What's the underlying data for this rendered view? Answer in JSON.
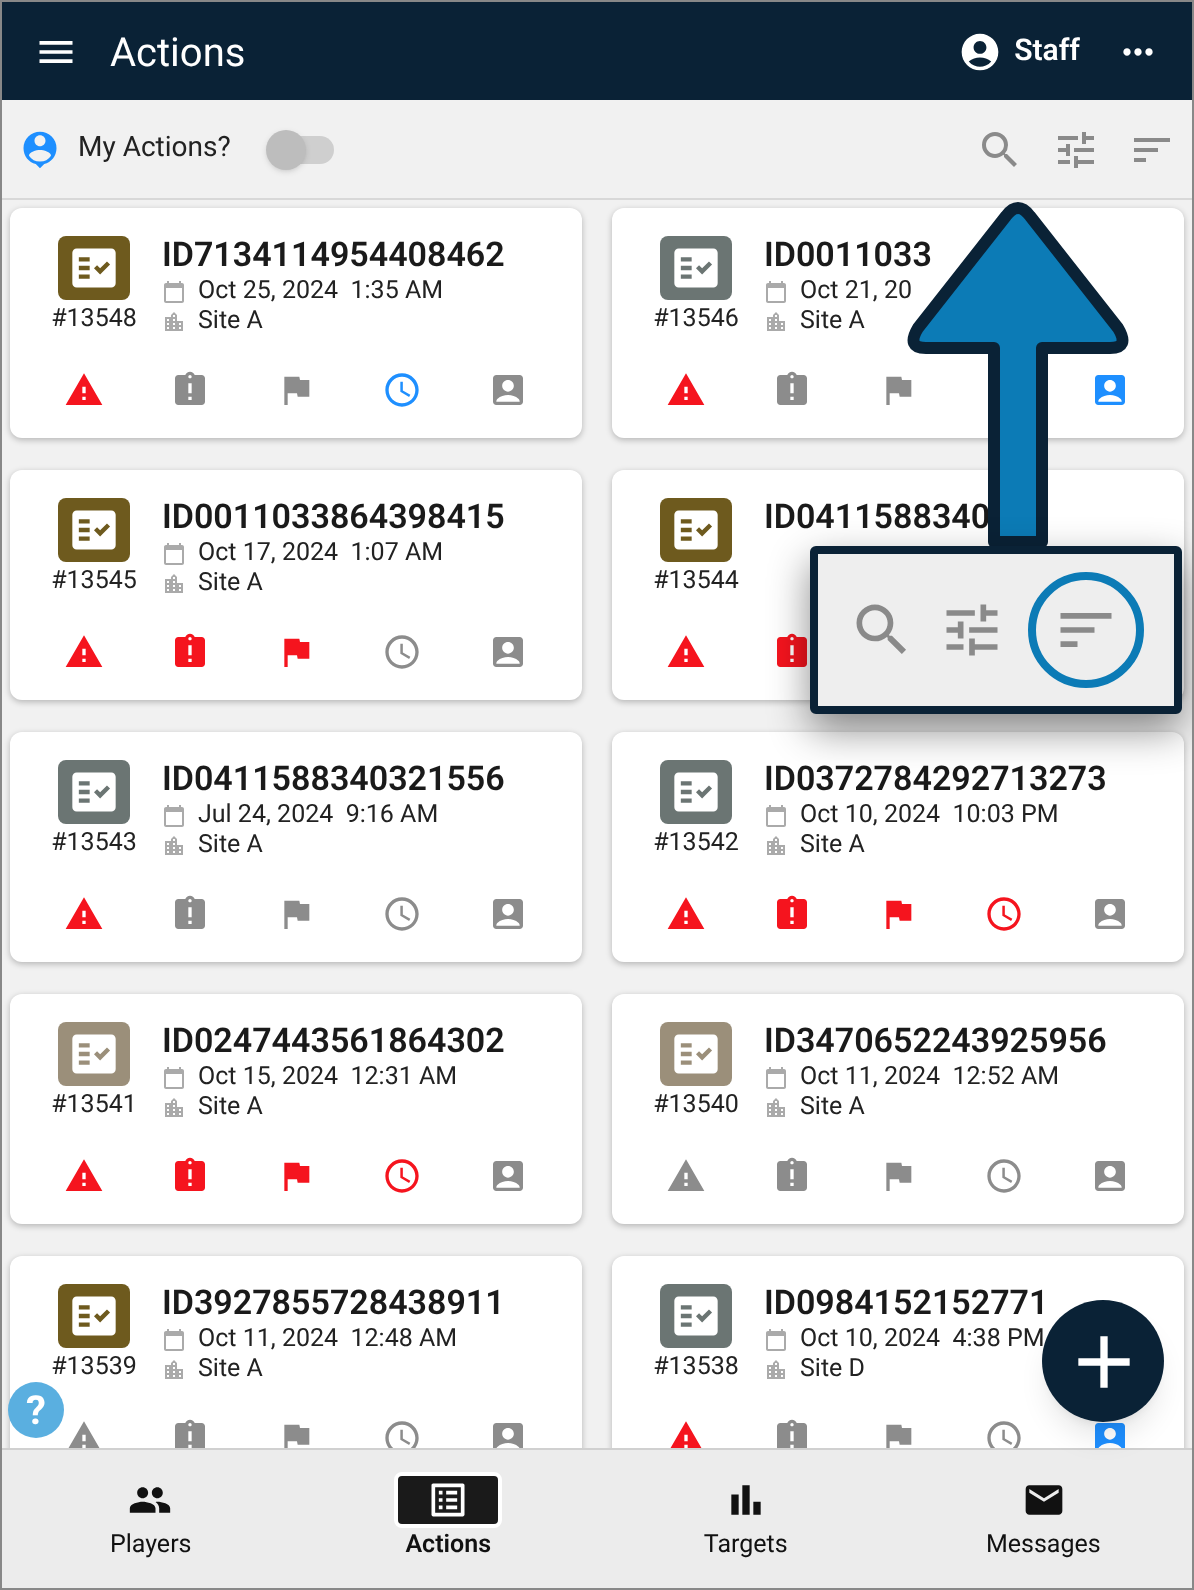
{
  "app_bar": {
    "title": "Actions",
    "user": "Staff"
  },
  "toolbar": {
    "label": "My Actions?",
    "toggle_on": false
  },
  "cards": [
    {
      "id": "ID7134114954408462",
      "number": "#13548",
      "date": "Oct 25, 2024  1:35 AM",
      "site": "Site A",
      "color": "#6e5a1e",
      "flags": [
        {
          "kind": "warning",
          "color": "#f5141e"
        },
        {
          "kind": "clipboard",
          "color": "#8c8c8c"
        },
        {
          "kind": "flag",
          "color": "#8c8c8c"
        },
        {
          "kind": "clock",
          "color": "#1e8fff"
        },
        {
          "kind": "person",
          "color": "#8c8c8c"
        }
      ]
    },
    {
      "id": "ID0011033",
      "number": "#13546",
      "date": "Oct 21, 20",
      "site": "Site A",
      "color": "#6b7573",
      "flags": [
        {
          "kind": "warning",
          "color": "#f5141e"
        },
        {
          "kind": "clipboard",
          "color": "#8c8c8c"
        },
        {
          "kind": "flag",
          "color": "#8c8c8c"
        },
        {
          "kind": "person",
          "color": "#1e8fff"
        }
      ]
    },
    {
      "id": "ID0011033864398415",
      "number": "#13545",
      "date": "Oct 17, 2024  1:07 AM",
      "site": "Site A",
      "color": "#6e5a1e",
      "flags": [
        {
          "kind": "warning",
          "color": "#f5141e"
        },
        {
          "kind": "clipboard",
          "color": "#f5141e"
        },
        {
          "kind": "flag",
          "color": "#f5141e"
        },
        {
          "kind": "clock",
          "color": "#8c8c8c"
        },
        {
          "kind": "person",
          "color": "#8c8c8c"
        }
      ]
    },
    {
      "id": "ID0411588340",
      "number": "#13544",
      "color": "#6e5a1e",
      "flags": [
        {
          "kind": "warning",
          "color": "#f5141e"
        },
        {
          "kind": "clipboard",
          "color": "#f5141e"
        }
      ]
    },
    {
      "id": "ID0411588340321556",
      "number": "#13543",
      "date": "Jul 24, 2024  9:16 AM",
      "site": "Site A",
      "color": "#6b7573",
      "flags": [
        {
          "kind": "warning",
          "color": "#f5141e"
        },
        {
          "kind": "clipboard",
          "color": "#8c8c8c"
        },
        {
          "kind": "flag",
          "color": "#8c8c8c"
        },
        {
          "kind": "clock",
          "color": "#8c8c8c"
        },
        {
          "kind": "person",
          "color": "#8c8c8c"
        }
      ]
    },
    {
      "id": "ID0372784292713273",
      "number": "#13542",
      "date": "Oct 10, 2024  10:03 PM",
      "site": "Site A",
      "color": "#6b7573",
      "flags": [
        {
          "kind": "warning",
          "color": "#f5141e"
        },
        {
          "kind": "clipboard",
          "color": "#f5141e"
        },
        {
          "kind": "flag",
          "color": "#f5141e"
        },
        {
          "kind": "clock",
          "color": "#f5141e"
        },
        {
          "kind": "person",
          "color": "#8c8c8c"
        }
      ]
    },
    {
      "id": "ID0247443561864302",
      "number": "#13541",
      "date": "Oct 15, 2024  12:31 AM",
      "site": "Site A",
      "color": "#9b8f7a",
      "flags": [
        {
          "kind": "warning",
          "color": "#f5141e"
        },
        {
          "kind": "clipboard",
          "color": "#f5141e"
        },
        {
          "kind": "flag",
          "color": "#f5141e"
        },
        {
          "kind": "clock",
          "color": "#f5141e"
        },
        {
          "kind": "person",
          "color": "#8c8c8c"
        }
      ]
    },
    {
      "id": "ID3470652243925956",
      "number": "#13540",
      "date": "Oct 11, 2024  12:52 AM",
      "site": "Site A",
      "color": "#9b8f7a",
      "flags": [
        {
          "kind": "warning",
          "color": "#8c8c8c"
        },
        {
          "kind": "clipboard",
          "color": "#8c8c8c"
        },
        {
          "kind": "flag",
          "color": "#8c8c8c"
        },
        {
          "kind": "clock",
          "color": "#8c8c8c"
        },
        {
          "kind": "person",
          "color": "#8c8c8c"
        }
      ]
    },
    {
      "id": "ID3927855728438911",
      "number": "#13539",
      "date": "Oct 11, 2024  12:48 AM",
      "site": "Site A",
      "color": "#6e5a1e",
      "flags": [
        {
          "kind": "warning",
          "color": "#8c8c8c"
        },
        {
          "kind": "clipboard",
          "color": "#8c8c8c"
        },
        {
          "kind": "flag",
          "color": "#8c8c8c"
        },
        {
          "kind": "clock",
          "color": "#8c8c8c"
        },
        {
          "kind": "person",
          "color": "#8c8c8c"
        }
      ]
    },
    {
      "id": "ID0984152152771",
      "number": "#13538",
      "date": "Oct 10, 2024  4:38 PM",
      "site": "Site D",
      "color": "#6b7573",
      "flags": [
        {
          "kind": "warning",
          "color": "#f5141e"
        },
        {
          "kind": "clipboard",
          "color": "#8c8c8c"
        },
        {
          "kind": "flag",
          "color": "#8c8c8c"
        },
        {
          "kind": "clock",
          "color": "#8c8c8c"
        },
        {
          "kind": "person",
          "color": "#1e8fff"
        }
      ]
    }
  ],
  "help": {
    "label": "?"
  },
  "nav": [
    {
      "label": "Players",
      "kind": "players",
      "selected": false
    },
    {
      "label": "Actions",
      "kind": "actions",
      "selected": true
    },
    {
      "label": "Targets",
      "kind": "targets",
      "selected": false
    },
    {
      "label": "Messages",
      "kind": "messages",
      "selected": false
    }
  ]
}
